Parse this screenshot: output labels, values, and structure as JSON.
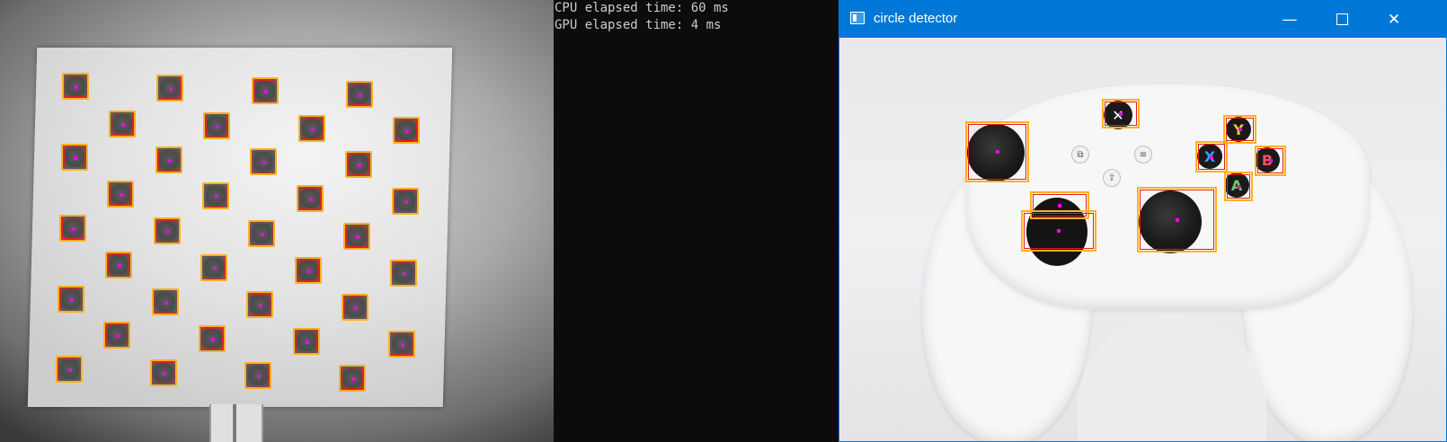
{
  "console": {
    "lines": [
      "CPU elapsed time: 60 ms",
      "GPU elapsed time: 4 ms"
    ]
  },
  "window": {
    "title": "circle detector",
    "buttons": {
      "minimize": "—",
      "close": "✕"
    }
  },
  "controller": {
    "face_buttons": {
      "y": "Y",
      "x": "X",
      "b": "B",
      "a": "A"
    },
    "small_buttons": {
      "view": "⧉",
      "menu": "≡",
      "share": "⇪"
    }
  },
  "colors": {
    "detection_box": "#ffb020",
    "detection_box_inner": "#e02020",
    "detection_center": "#e010e0",
    "titlebar": "#0078d7"
  }
}
